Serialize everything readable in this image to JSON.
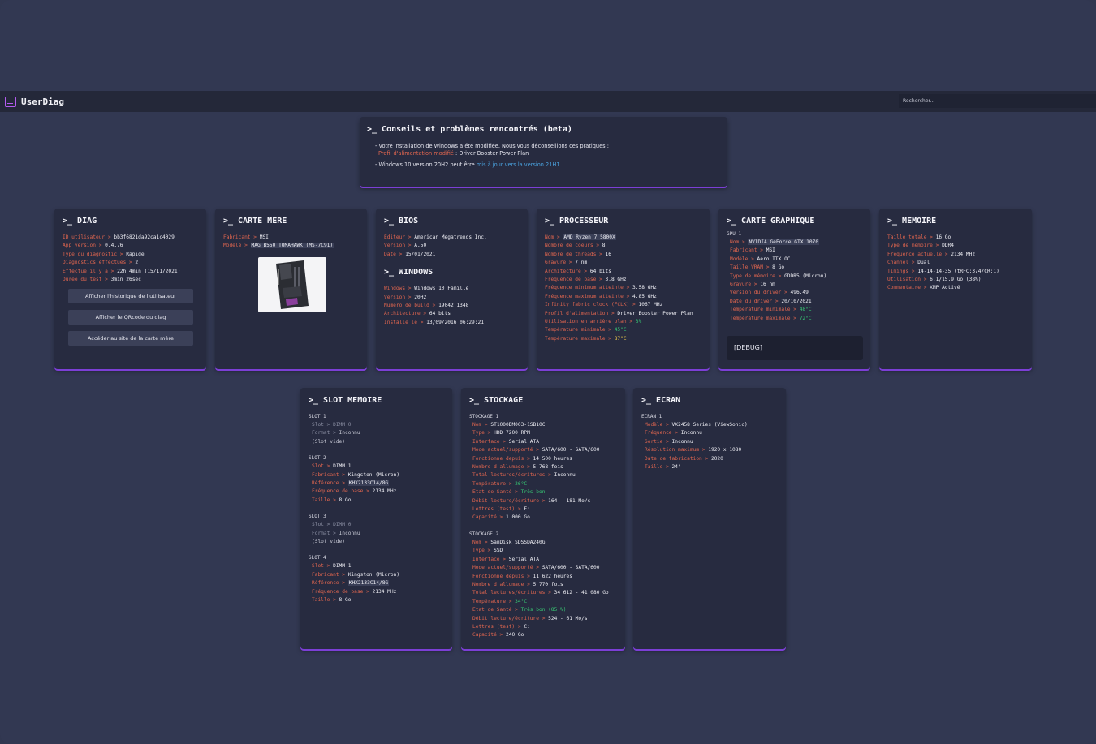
{
  "app": {
    "title": "UserDiag",
    "search_placeholder": "Rechercher..."
  },
  "colors": {
    "background": "#323852",
    "card": "#272b40",
    "navbar": "#242839",
    "accent": "#7c3fd6",
    "key": "#e1664f",
    "green": "#37c873",
    "yellow": "#e6c34a",
    "link_blue": "#4aa3e0"
  },
  "advice": {
    "title": ">_ Conseils et problèmes rencontrés (beta)",
    "line1": "- Votre installation de Windows a été modifiée. Nous vous déconseillons ces pratiques :",
    "line1_link": "Profil d'alimentation modifié",
    "line1_rest": " : Driver Booster Power Plan",
    "line2_pre": "- Windows 10 version 20H2 peut être ",
    "line2_link": "mis à jour vers la version 21H1",
    "line2_post": "."
  },
  "diag": {
    "title": ">_ DIAG",
    "rows": [
      {
        "k": "ID utilisateur",
        "v": "bb3f6821da92ca1c4029"
      },
      {
        "k": "App version",
        "v": "0.4.76"
      },
      {
        "k": "Type du diagnostic",
        "v": "Rapide"
      },
      {
        "k": "Diagnostics effectués",
        "v": "2"
      },
      {
        "k": "Effectué il y a",
        "v": "22h 4min (15/11/2021)"
      },
      {
        "k": "Durée du test",
        "v": "3min 26sec"
      }
    ],
    "buttons": [
      "Afficher l'historique de l'utilisateur",
      "Afficher le QRcode du diag",
      "Accéder au site de la carte mère"
    ]
  },
  "motherboard": {
    "title": ">_ CARTE MERE",
    "rows": [
      {
        "k": "Fabricant",
        "v": "MSI"
      },
      {
        "k": "Modèle",
        "v": "MAG B550 TOMAHAWK (MS-7C91)"
      }
    ]
  },
  "bios": {
    "title": ">_ BIOS",
    "rows": [
      {
        "k": "Editeur",
        "v": "American Megatrends Inc."
      },
      {
        "k": "Version",
        "v": "A.50"
      },
      {
        "k": "Date",
        "v": "15/01/2021"
      }
    ]
  },
  "windows": {
    "title": ">_ WINDOWS",
    "rows": [
      {
        "k": "Windows",
        "v": "Windows 10 Famille"
      },
      {
        "k": "Version",
        "v": "20H2"
      },
      {
        "k": "Numéro de build",
        "v": "19042.1348"
      },
      {
        "k": "Architecture",
        "v": "64 bits"
      },
      {
        "k": "Installé le",
        "v": "13/09/2016 06:29:21"
      }
    ]
  },
  "cpu": {
    "title": ">_ PROCESSEUR",
    "rows": [
      {
        "k": "Nom",
        "v": "AMD Ryzen 7 5800X"
      },
      {
        "k": "Nombre de coeurs",
        "v": "8"
      },
      {
        "k": "Nombre de threads",
        "v": "16"
      },
      {
        "k": "Gravure",
        "v": "7 nm"
      },
      {
        "k": "Architecture",
        "v": "64 bits"
      },
      {
        "k": "Fréquence de base",
        "v": "3.8 GHz"
      },
      {
        "k": "Fréquence minimum atteinte",
        "v": "3.58 GHz"
      },
      {
        "k": "Fréquence maximum atteinte",
        "v": "4.85 GHz"
      },
      {
        "k": "Infinity fabric clock (FCLK)",
        "v": "1067 MHz"
      },
      {
        "k": "Profil d'alimentation",
        "v": "Driver Booster Power Plan"
      },
      {
        "k": "Utilisation en arrière plan",
        "v": "3%"
      },
      {
        "k": "Température minimale",
        "v": "45°C"
      },
      {
        "k": "Température maximale",
        "v": "87°C"
      }
    ]
  },
  "gpu": {
    "title": ">_ CARTE GRAPHIQUE",
    "subtitle": "GPU 1",
    "rows": [
      {
        "k": "Nom",
        "v": "NVIDIA GeForce GTX 1070"
      },
      {
        "k": "Fabricant",
        "v": "MSI"
      },
      {
        "k": "Modèle",
        "v": "Aero ITX OC"
      },
      {
        "k": "Taille VRAM",
        "v": "8 Go"
      },
      {
        "k": "Type de mémoire",
        "v": "GDDR5 (Micron)"
      },
      {
        "k": "Gravure",
        "v": "16 nm"
      },
      {
        "k": "Version du driver",
        "v": "496.49"
      },
      {
        "k": "Date du driver",
        "v": "20/10/2021"
      },
      {
        "k": "Température minimale",
        "v": "48°C"
      },
      {
        "k": "Température maximale",
        "v": "72°C"
      }
    ],
    "debug": "[DEBUG]"
  },
  "memory": {
    "title": ">_ MEMOIRE",
    "rows": [
      {
        "k": "Taille totale",
        "v": "16 Go"
      },
      {
        "k": "Type de mémoire",
        "v": "DDR4"
      },
      {
        "k": "Fréquence actuelle",
        "v": "2134 MHz"
      },
      {
        "k": "Channel",
        "v": "Dual"
      },
      {
        "k": "Timings",
        "v": "14-14-14-35 (tRFC:374/CR:1)"
      },
      {
        "k": "Utilisation",
        "v": "6.1/15.9 Go (38%)"
      },
      {
        "k": "Commentaire",
        "v": "XMP Activé"
      }
    ]
  },
  "slots": {
    "title": ">_ SLOT MEMOIRE",
    "slot1": {
      "label": "SLOT 1",
      "rows": [
        {
          "k": "Slot",
          "v": "DIMM 0"
        },
        {
          "k": "Format",
          "v": "Inconnu"
        }
      ],
      "note": "(Slot vide)"
    },
    "slot2": {
      "label": "SLOT 2",
      "rows": [
        {
          "k": "Slot",
          "v": "DIMM 1"
        },
        {
          "k": "Fabricant",
          "v": "Kingston (Micron)"
        },
        {
          "k": "Référence",
          "v": "KHX2133C14/8G"
        },
        {
          "k": "Fréquence de base",
          "v": "2134 MHz"
        },
        {
          "k": "Taille",
          "v": "8 Go"
        }
      ]
    },
    "slot3": {
      "label": "SLOT 3",
      "rows": [
        {
          "k": "Slot",
          "v": "DIMM 0"
        },
        {
          "k": "Format",
          "v": "Inconnu"
        }
      ],
      "note": "(Slot vide)"
    },
    "slot4": {
      "label": "SLOT 4",
      "rows": [
        {
          "k": "Slot",
          "v": "DIMM 1"
        },
        {
          "k": "Fabricant",
          "v": "Kingston (Micron)"
        },
        {
          "k": "Référence",
          "v": "KHX2133C14/8G"
        },
        {
          "k": "Fréquence de base",
          "v": "2134 MHz"
        },
        {
          "k": "Taille",
          "v": "8 Go"
        }
      ]
    }
  },
  "storage": {
    "title": ">_ STOCKAGE",
    "disk1": {
      "label": "STOCKAGE 1",
      "rows": [
        {
          "k": "Nom",
          "v": "ST1000DM003-1SB10C"
        },
        {
          "k": "Type",
          "v": "HDD 7200 RPM"
        },
        {
          "k": "Interface",
          "v": "Serial ATA"
        },
        {
          "k": "Mode actuel/supporté",
          "v": "SATA/600 - SATA/600"
        },
        {
          "k": "Fonctionne depuis",
          "v": "14 500 heures"
        },
        {
          "k": "Nombre d'allumage",
          "v": "5 768 fois"
        },
        {
          "k": "Total lectures/écritures",
          "v": "Inconnu"
        },
        {
          "k": "Température",
          "v": "26°C"
        },
        {
          "k": "Etat de Santé",
          "v": "Très bon"
        },
        {
          "k": "Débit lecture/écriture",
          "v": "164 - 181 Mo/s"
        },
        {
          "k": "Lettres (test)",
          "v": "F:"
        },
        {
          "k": "Capacité",
          "v": "1 000 Go"
        }
      ]
    },
    "disk2": {
      "label": "STOCKAGE 2",
      "rows": [
        {
          "k": "Nom",
          "v": "SanDisk SDSSDA240G"
        },
        {
          "k": "Type",
          "v": "SSD"
        },
        {
          "k": "Interface",
          "v": "Serial ATA"
        },
        {
          "k": "Mode actuel/supporté",
          "v": "SATA/600 - SATA/600"
        },
        {
          "k": "Fonctionne depuis",
          "v": "11 622 heures"
        },
        {
          "k": "Nombre d'allumage",
          "v": "5 770 fois"
        },
        {
          "k": "Total lectures/écritures",
          "v": "34 612 - 41 080 Go"
        },
        {
          "k": "Température",
          "v": "34°C"
        },
        {
          "k": "Etat de Santé",
          "v": "Très bon (85 %)"
        },
        {
          "k": "Débit lecture/écriture",
          "v": "524 - 61 Mo/s"
        },
        {
          "k": "Lettres (test)",
          "v": "C:"
        },
        {
          "k": "Capacité",
          "v": "240 Go"
        }
      ]
    }
  },
  "screen": {
    "title": ">_ ECRAN",
    "subtitle": "ECRAN 1",
    "rows": [
      {
        "k": "Modèle",
        "v": "VX2458 Series (ViewSonic)"
      },
      {
        "k": "Fréquence",
        "v": "Inconnu"
      },
      {
        "k": "Sortie",
        "v": "Inconnu"
      },
      {
        "k": "Résolution maximum",
        "v": "1920 x 1080"
      },
      {
        "k": "Date de fabrication",
        "v": "2020"
      },
      {
        "k": "Taille",
        "v": "24\""
      }
    ]
  }
}
